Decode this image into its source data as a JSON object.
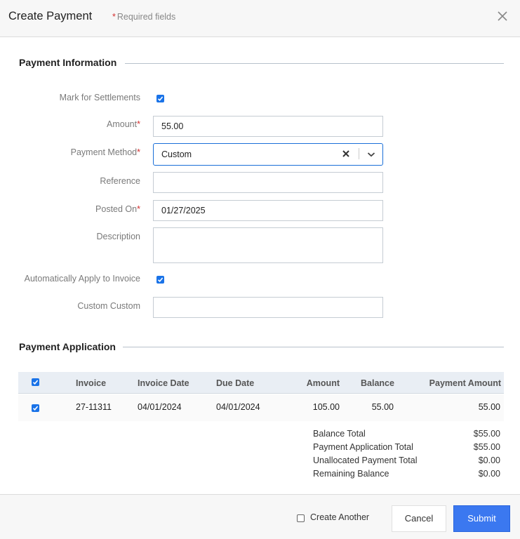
{
  "header": {
    "title": "Create Payment",
    "required_star": "*",
    "required_text": "Required fields",
    "close_icon": "close-icon"
  },
  "payment_info": {
    "section_title": "Payment Information",
    "mark_for_settlements": {
      "label": "Mark for Settlements",
      "checked": true
    },
    "amount": {
      "label": "Amount",
      "required": "*",
      "value": "55.00"
    },
    "payment_method": {
      "label": "Payment Method",
      "required": "*",
      "value": "Custom",
      "clear_icon": "x-icon",
      "dropdown_icon": "chevron-down-icon"
    },
    "reference": {
      "label": "Reference",
      "value": ""
    },
    "posted_on": {
      "label": "Posted On",
      "required": "*",
      "value": "01/27/2025"
    },
    "description": {
      "label": "Description",
      "value": ""
    },
    "auto_apply": {
      "label": "Automatically Apply to Invoice",
      "checked": true
    },
    "custom_custom": {
      "label": "Custom Custom",
      "value": ""
    }
  },
  "payment_application": {
    "section_title": "Payment Application",
    "columns": [
      "Invoice",
      "Invoice Date",
      "Due Date",
      "Amount",
      "Balance",
      "Payment Amount"
    ],
    "select_all_checked": true,
    "rows": [
      {
        "checked": true,
        "invoice": "27-11311",
        "invoice_date": "04/01/2024",
        "due_date": "04/01/2024",
        "amount": "105.00",
        "balance": "55.00",
        "payment_amount": "55.00"
      }
    ],
    "totals": [
      {
        "label": "Balance Total",
        "value": "$55.00"
      },
      {
        "label": "Payment Application Total",
        "value": "$55.00"
      },
      {
        "label": "Unallocated Payment Total",
        "value": "$0.00"
      },
      {
        "label": "Remaining Balance",
        "value": "$0.00"
      }
    ]
  },
  "footer": {
    "create_another_label": "Create Another",
    "create_another_checked": false,
    "cancel_label": "Cancel",
    "submit_label": "Submit"
  },
  "colors": {
    "accent": "#3b78f0",
    "checkbox": "#1a73e8",
    "required": "#d32f2f"
  }
}
